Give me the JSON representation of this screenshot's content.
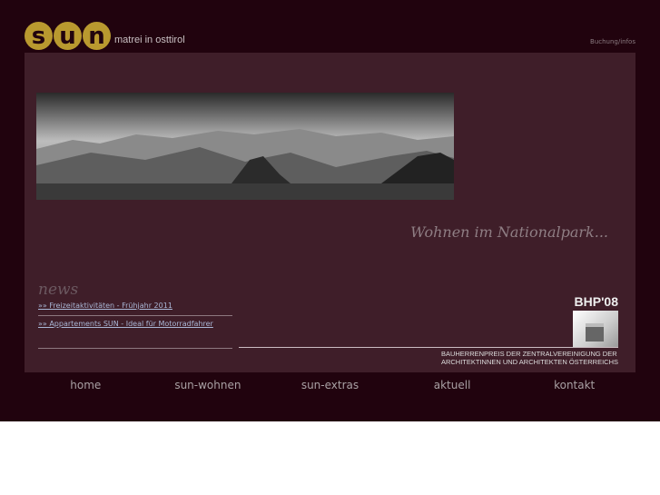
{
  "logo": {
    "letters": [
      "s",
      "u",
      "n"
    ],
    "tagline": "matrei in osttirol"
  },
  "header": {
    "booking_link": "Buchung/infos"
  },
  "hero": {
    "slogan": "Wohnen im Nationalpark..."
  },
  "news": {
    "heading": "news",
    "items": [
      {
        "label": "»» Freizeitaktivitäten - Frühjahr 2011"
      },
      {
        "label": "»» Appartements SUN - Ideal für Motorradfahrer"
      }
    ]
  },
  "award": {
    "title": "BHP'08",
    "description_line1": "BAUHERRENPREIS DER ZENTRALVEREINIGUNG DER",
    "description_line2": "ARCHITEKTINNEN UND ARCHITEKTEN ÖSTERREICHS"
  },
  "nav": [
    "home",
    "sun-wohnen",
    "sun-extras",
    "aktuell",
    "kontakt"
  ],
  "colors": {
    "background": "#21030e",
    "panel": "#3f1e29",
    "logo": "#b9992f"
  }
}
